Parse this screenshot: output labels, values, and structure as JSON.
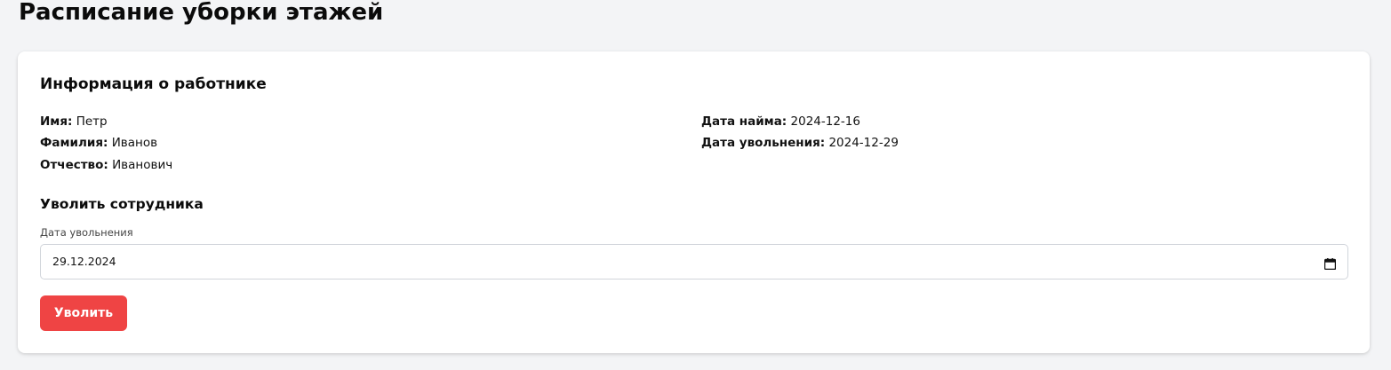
{
  "page": {
    "title": "Расписание уборки этажей"
  },
  "employee_info": {
    "title": "Информация о работнике",
    "first_name": {
      "label": "Имя:",
      "value": "Петр"
    },
    "last_name": {
      "label": "Фамилия:",
      "value": "Иванов"
    },
    "patronymic": {
      "label": "Отчество:",
      "value": "Иванович"
    },
    "hire_date": {
      "label": "Дата найма:",
      "value": "2024-12-16"
    },
    "dismissal_date": {
      "label": "Дата увольнения:",
      "value": "2024-12-29"
    }
  },
  "dismiss_form": {
    "title": "Уволить сотрудника",
    "date_label": "Дата увольнения",
    "date_value": "29.12.2024",
    "submit_label": "Уволить"
  },
  "icons": {
    "date_picker": "calendar-icon"
  },
  "colors": {
    "danger": "#ef4444",
    "card_background": "#ffffff",
    "page_background": "#f3f4f6"
  }
}
